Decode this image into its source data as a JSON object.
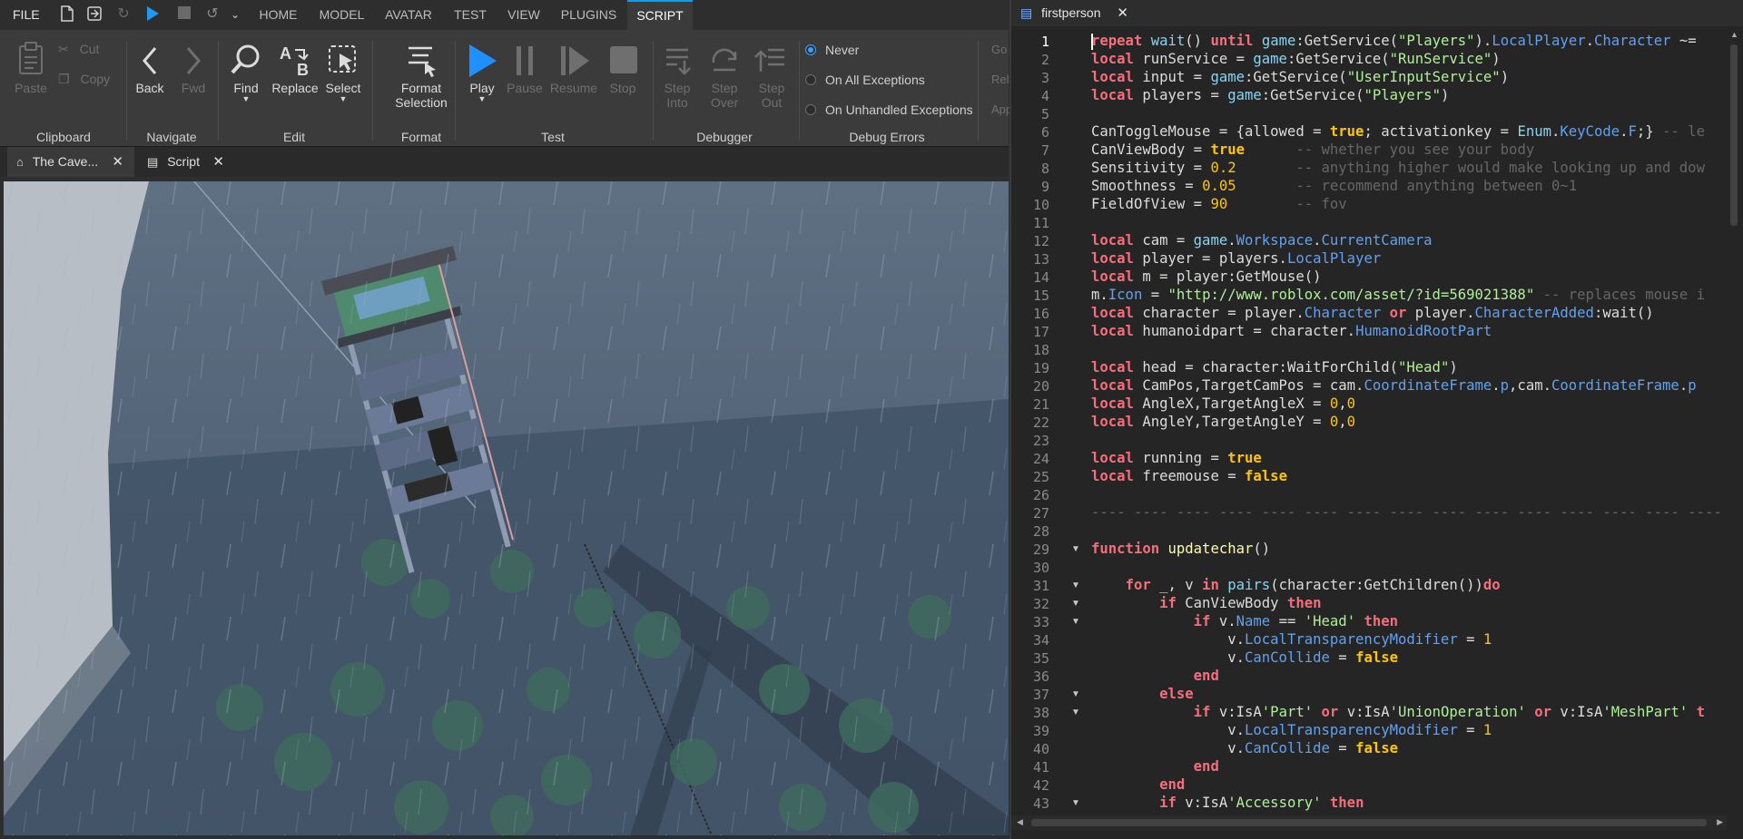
{
  "menubar": {
    "file": "FILE",
    "tabs": [
      "HOME",
      "MODEL",
      "AVATAR",
      "TEST",
      "VIEW",
      "PLUGINS",
      "SCRIPT"
    ],
    "active_tab": "SCRIPT"
  },
  "ribbon": {
    "clipboard": {
      "paste": "Paste",
      "cut": "Cut",
      "copy": "Copy",
      "group": "Clipboard"
    },
    "navigate": {
      "back": "Back",
      "fwd": "Fwd",
      "group": "Navigate"
    },
    "edit": {
      "find": "Find",
      "replace": "Replace",
      "select": "Select",
      "group": "Edit"
    },
    "format": {
      "line1": "Format",
      "line2": "Selection",
      "group": "Format"
    },
    "test": {
      "play": "Play",
      "pause": "Pause",
      "resume": "Resume",
      "stop": "Stop",
      "group": "Test"
    },
    "debugger": {
      "step_into_1": "Step",
      "step_into_2": "Into",
      "step_over_1": "Step",
      "step_over_2": "Over",
      "step_out_1": "Step",
      "step_out_2": "Out",
      "group": "Debugger"
    },
    "debug_errors": {
      "never": "Never",
      "all": "On All Exceptions",
      "unhandled": "On Unhandled Exceptions",
      "group": "Debug Errors",
      "selected": "Never"
    },
    "cutoff": {
      "a": "Go",
      "b": "Rel",
      "c": "App"
    }
  },
  "doc_tabs": [
    {
      "label": "The Cave...",
      "icon": "place-icon"
    },
    {
      "label": "Script",
      "icon": "script-icon"
    }
  ],
  "editor": {
    "tab_title": "firstperson",
    "current_line": 1
  },
  "colors": {
    "accent": "#00a2ff",
    "keyword": "#f86d7c",
    "string": "#adf195",
    "number": "#ffc600",
    "builtin": "#84d6f7",
    "comment": "#666666"
  }
}
